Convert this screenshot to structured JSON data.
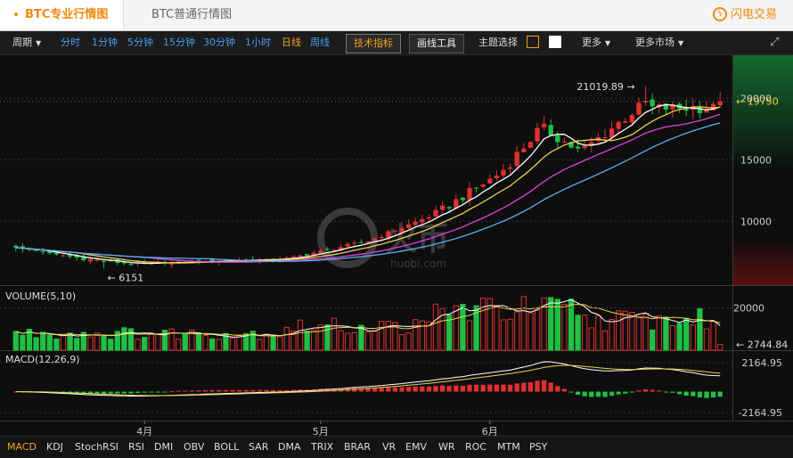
{
  "tabs": {
    "active": "BTC专业行情图",
    "second": "BTC普通行情图"
  },
  "brand": {
    "label": "闪电交易"
  },
  "toolbar": {
    "period_label": "周期",
    "intervals": [
      "分时",
      "1分钟",
      "5分钟",
      "15分钟",
      "30分钟",
      "1小时",
      "日线",
      "周线"
    ],
    "active_interval": "日线",
    "tech_button": "技术指标",
    "draw_button": "画线工具",
    "theme_label": "主题选择",
    "more_label": "更多",
    "more_markets_label": "更多市场"
  },
  "watermark": {
    "text": "火币",
    "subtext": "huobi.com"
  },
  "chart_data": [
    {
      "type": "candlestick",
      "name": "BTC",
      "y_ticks": [
        10000,
        15000,
        20000
      ],
      "ylim": [
        4800,
        23500
      ],
      "last_price": "19750",
      "high_marker": "21019.89",
      "low_marker": "6151",
      "x_ticks": [
        "4月",
        "5月",
        "6月"
      ],
      "colors": {
        "up": "#e03030",
        "down": "#1fc043",
        "ma5": "#ffffff",
        "ma10": "#e8d24a",
        "ma20": "#e040e0",
        "ma30": "#5ab0f0"
      }
    },
    {
      "type": "bar",
      "title": "VOLUME(5,10)",
      "y_ticks": [
        20000
      ],
      "last_value": "2744.84"
    },
    {
      "type": "bar",
      "title": "MACD(12,26,9)",
      "y_ticks": [
        2164.95,
        -2164.95
      ],
      "y_tick_labels": [
        "2164.95",
        "-2164.95"
      ]
    }
  ],
  "indicators": [
    "MACD",
    "KDJ",
    "StochRSI",
    "RSI",
    "DMI",
    "OBV",
    "BOLL",
    "SAR",
    "DMA",
    "TRIX",
    "BRAR",
    "VR",
    "EMV",
    "WR",
    "ROC",
    "MTM",
    "PSY"
  ],
  "active_indicator": "MACD"
}
